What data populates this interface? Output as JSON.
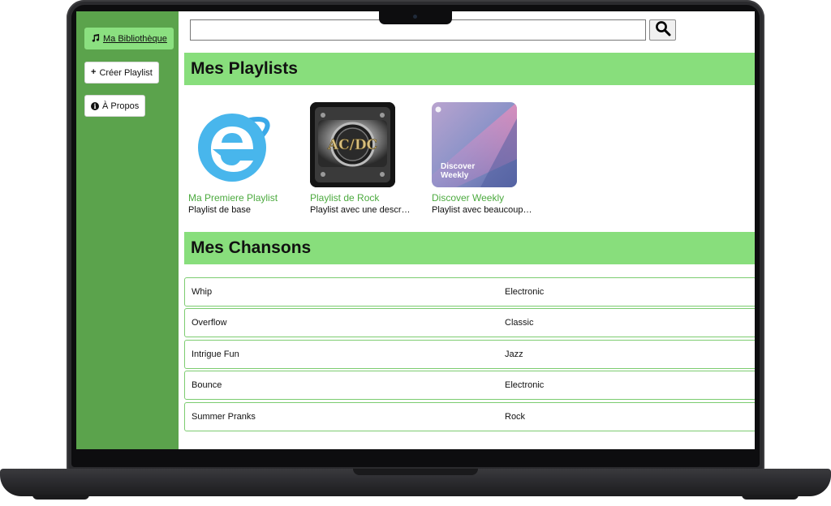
{
  "sidebar": {
    "items": [
      {
        "label": "Ma Bibliothèque",
        "icon": "music-note-icon"
      },
      {
        "label": "Créer Playlist",
        "icon": "plus-icon"
      },
      {
        "label": "À Propos",
        "icon": "info-icon"
      }
    ]
  },
  "search": {
    "value": "",
    "placeholder": "",
    "button_icon": "search-icon"
  },
  "playlists_section": {
    "title": "Mes Playlists"
  },
  "playlists": [
    {
      "title": "Ma Premiere Playlist",
      "description": "Playlist de base",
      "cover_icon": "internet-explorer-logo"
    },
    {
      "title": "Playlist de Rock",
      "description": "Playlist avec une description longue",
      "cover_icon": "acdc-logo",
      "cover_text": "AC/DC"
    },
    {
      "title": "Discover Weekly",
      "description": "Playlist avec beaucoup de chansons",
      "cover_icon": "discover-weekly-cover",
      "cover_text": "Discover Weekly"
    }
  ],
  "songs_section": {
    "title": "Mes Chansons"
  },
  "songs": [
    {
      "title": "Whip",
      "genre": "Electronic"
    },
    {
      "title": "Overflow",
      "genre": "Classic"
    },
    {
      "title": "Intrigue Fun",
      "genre": "Jazz"
    },
    {
      "title": "Bounce",
      "genre": "Electronic"
    },
    {
      "title": "Summer Pranks",
      "genre": "Rock"
    }
  ],
  "colors": {
    "sidebar_bg": "#5ba34c",
    "section_header_bg": "#88de7c",
    "active_button_bg": "#8be080",
    "playlist_title": "#4caa3f",
    "row_border": "#7ccc70"
  }
}
